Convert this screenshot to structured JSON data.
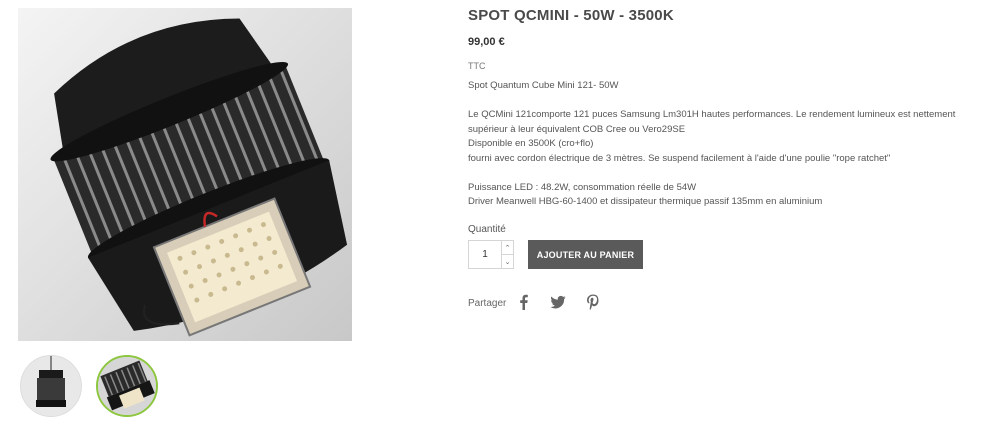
{
  "product": {
    "title": "SPOT QCMINI - 50W - 3500K",
    "price": "99,00 €",
    "tax_label": "TTC",
    "subtitle": "Spot Quantum Cube Mini 121- 50W",
    "description": [
      "Le QCMini 121comporte 121 puces Samsung Lm301H hautes performances.   Le rendement lumineux est nettement supérieur à leur équivalent COB Cree ou Vero29SE",
      "Disponible en 3500K (cro+flo)",
      "fourni avec cordon électrique de 3 mètres.  Se suspend facilement à l'aide d'une poulie \"rope ratchet\"",
      "Puissance LED : 48.2W, consommation réelle de 54W",
      "Driver Meanwell HBG-60-1400 et dissipateur thermique passif 135mm en aluminium"
    ]
  },
  "cart": {
    "quantity_label": "Quantité",
    "quantity_value": "1",
    "up_arrow": "⌃",
    "down_arrow": "⌄",
    "add_button": "AJOUTER AU PANIER"
  },
  "share": {
    "label": "Partager",
    "icons": [
      "facebook-icon",
      "twitter-icon",
      "pinterest-icon"
    ]
  },
  "colors": {
    "button_bg": "#5a5a5a",
    "selected_thumb_border": "#8dc63f"
  }
}
